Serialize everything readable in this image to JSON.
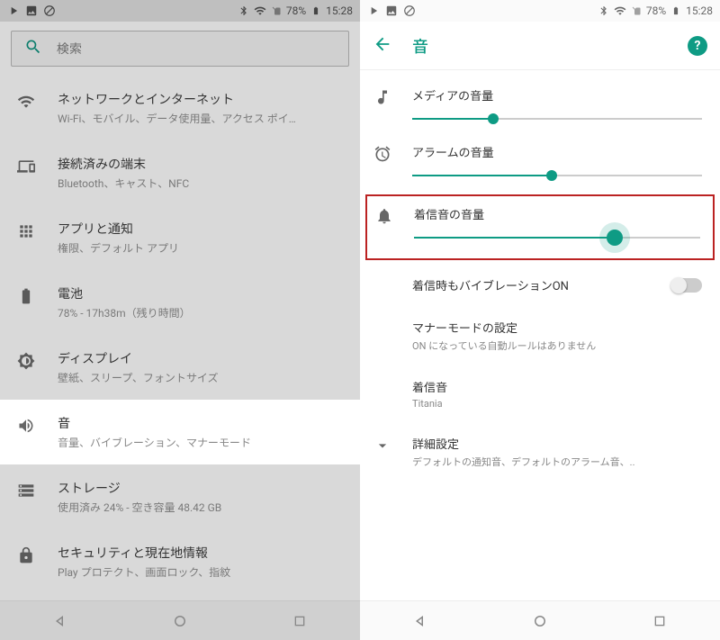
{
  "status": {
    "battery_pct": "78%",
    "time": "15:28"
  },
  "left": {
    "search_placeholder": "検索",
    "items": [
      {
        "title": "ネットワークとインターネット",
        "sub": "Wi-Fi、モバイル、データ使用量、アクセス ポイ…"
      },
      {
        "title": "接続済みの端末",
        "sub": "Bluetooth、キャスト、NFC"
      },
      {
        "title": "アプリと通知",
        "sub": "権限、デフォルト アプリ"
      },
      {
        "title": "電池",
        "sub": "78% - 17h38m（残り時間）"
      },
      {
        "title": "ディスプレイ",
        "sub": "壁紙、スリープ、フォントサイズ"
      },
      {
        "title": "音",
        "sub": "音量、バイブレーション、マナーモード"
      },
      {
        "title": "ストレージ",
        "sub": "使用済み 24% - 空き容量 48.42 GB"
      },
      {
        "title": "セキュリティと現在地情報",
        "sub": "Play プロテクト、画面ロック、指紋"
      }
    ]
  },
  "right": {
    "title": "音",
    "media_label": "メディアの音量",
    "media_pct": 28,
    "alarm_label": "アラームの音量",
    "alarm_pct": 48,
    "ring_label": "着信音の音量",
    "ring_pct": 70,
    "vibrate_label": "着信時もバイブレーションON",
    "vibrate_on": false,
    "dnd_title": "マナーモードの設定",
    "dnd_sub": "ON になっている自動ルールはありません",
    "ringtone_title": "着信音",
    "ringtone_sub": "Titania",
    "advanced_title": "詳細設定",
    "advanced_sub": "デフォルトの通知音、デフォルトのアラーム音、.."
  },
  "colors": {
    "accent": "#0e9b84",
    "highlight_border": "#b22222"
  }
}
